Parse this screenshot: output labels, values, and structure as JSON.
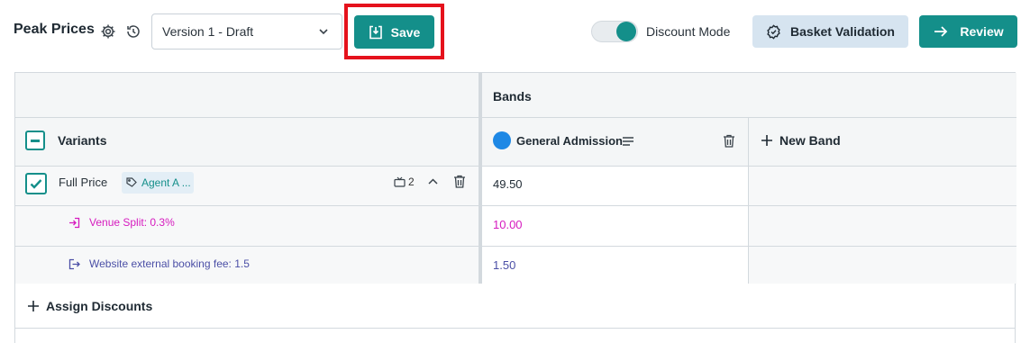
{
  "header": {
    "title": "Peak Prices",
    "version_select": {
      "value": "Version 1 - Draft"
    },
    "save_label": "Save",
    "discount_mode": {
      "label": "Discount Mode",
      "enabled": true
    },
    "basket_validation_label": "Basket Validation",
    "review_label": "Review"
  },
  "grid": {
    "bands_header": "Bands",
    "variants_header": "Variants",
    "bands": [
      {
        "name": "General Admission",
        "color": "#1e88e5"
      }
    ],
    "new_band_label": "New Band",
    "variants": [
      {
        "name": "Full Price",
        "tag": "Agent A ...",
        "count": "2",
        "checked": true,
        "value": "49.50",
        "sub_items": [
          {
            "label": "Venue Split: 0.3%",
            "value": "10.00",
            "color": "#d61bbf"
          },
          {
            "label": "Website external booking fee: 1.5",
            "value": "1.50",
            "color": "#4b4fa6"
          }
        ]
      }
    ],
    "assign_discounts_label": "Assign Discounts"
  },
  "colors": {
    "primary": "#148f8a",
    "highlight": "#e5121c",
    "secondary_button": "#d6e4f0"
  }
}
